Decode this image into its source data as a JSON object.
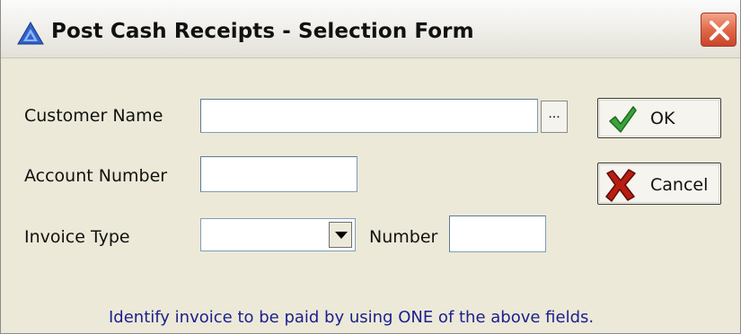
{
  "window": {
    "title": "Post Cash Receipts - Selection Form"
  },
  "form": {
    "customer_name_label": "Customer Name",
    "customer_name_value": "",
    "browse_label": "...",
    "account_number_label": "Account Number",
    "account_number_value": "",
    "invoice_type_label": "Invoice Type",
    "invoice_type_value": "",
    "number_label": "Number",
    "number_value": ""
  },
  "buttons": {
    "ok_label": "OK",
    "cancel_label": "Cancel"
  },
  "hint": "Identify invoice to be paid by using ONE of the above fields.",
  "icons": {
    "app": "triangle-app-icon",
    "close": "close-icon",
    "ok": "checkmark-icon",
    "cancel": "red-x-icon",
    "dropdown": "chevron-down-icon"
  }
}
